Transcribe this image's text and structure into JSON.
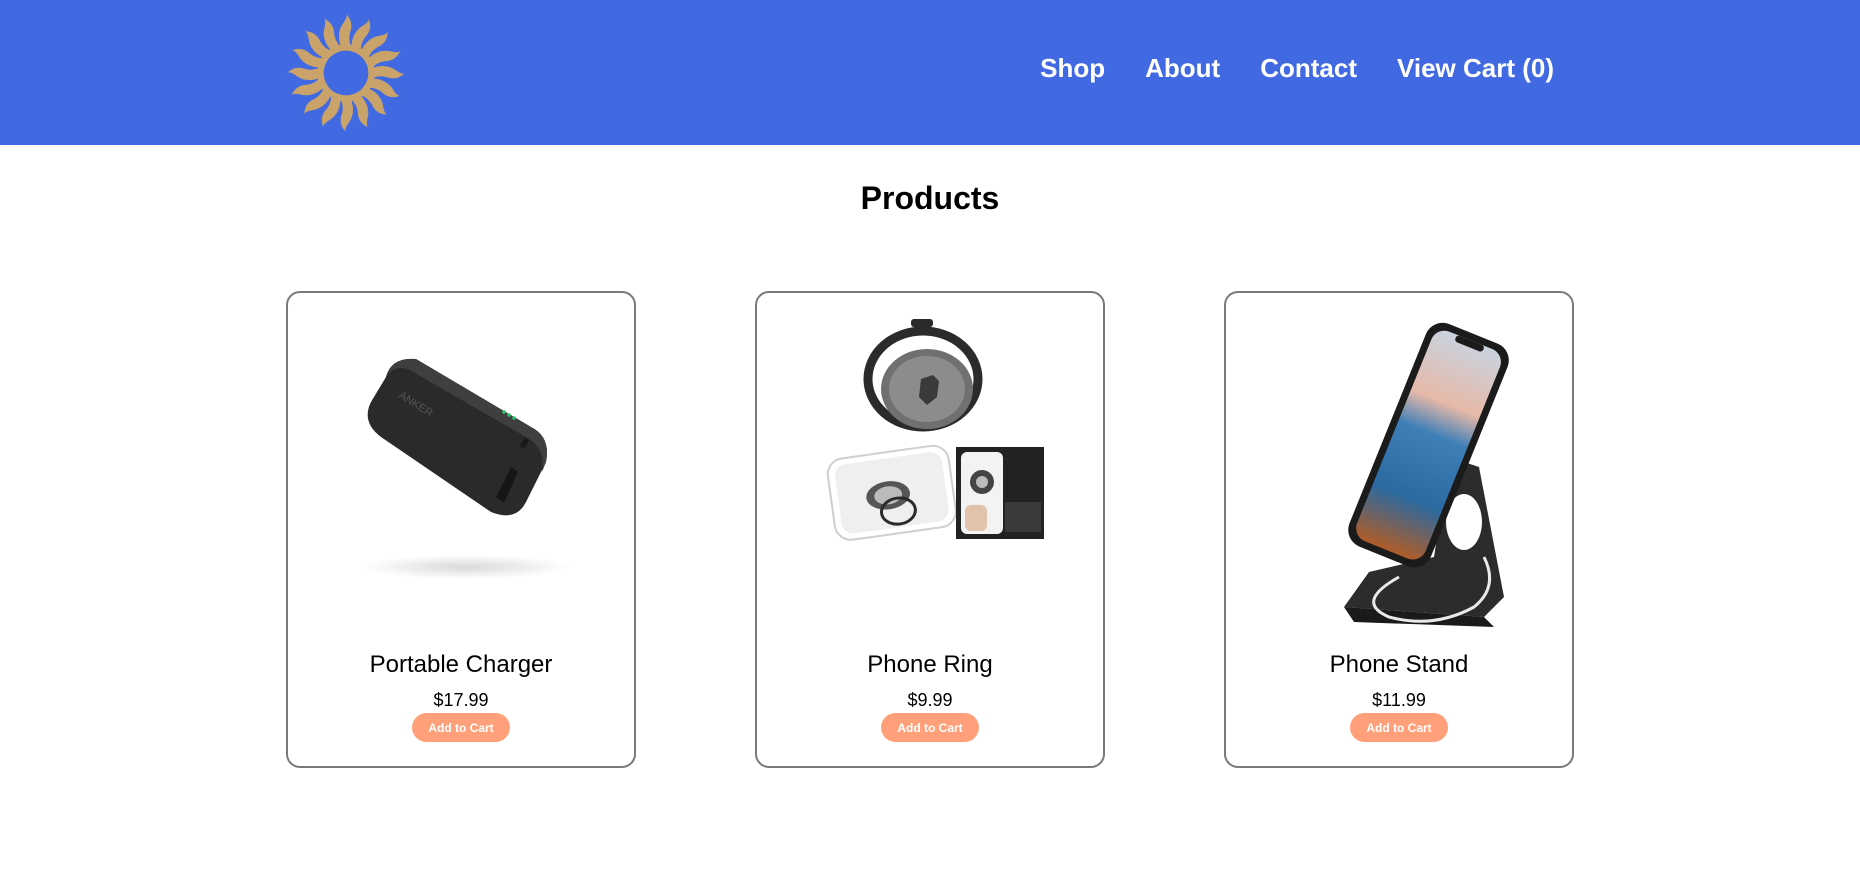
{
  "header": {
    "background": "#4169e1",
    "logo_icon": "sun-logo-icon",
    "nav": [
      {
        "label": "Shop"
      },
      {
        "label": "About"
      },
      {
        "label": "Contact"
      },
      {
        "label": "View Cart (0)"
      }
    ]
  },
  "main": {
    "title": "Products",
    "products": [
      {
        "name": "Portable Charger",
        "price": "$17.99",
        "button_label": "Add to Cart",
        "icon": "portable-charger-image"
      },
      {
        "name": "Phone Ring",
        "price": "$9.99",
        "button_label": "Add to Cart",
        "icon": "phone-ring-image"
      },
      {
        "name": "Phone Stand",
        "price": "$11.99",
        "button_label": "Add to Cart",
        "icon": "phone-stand-image"
      }
    ]
  },
  "colors": {
    "accent": "#4169e1",
    "button": "#ffa07a",
    "logo": "#c9a36a"
  }
}
